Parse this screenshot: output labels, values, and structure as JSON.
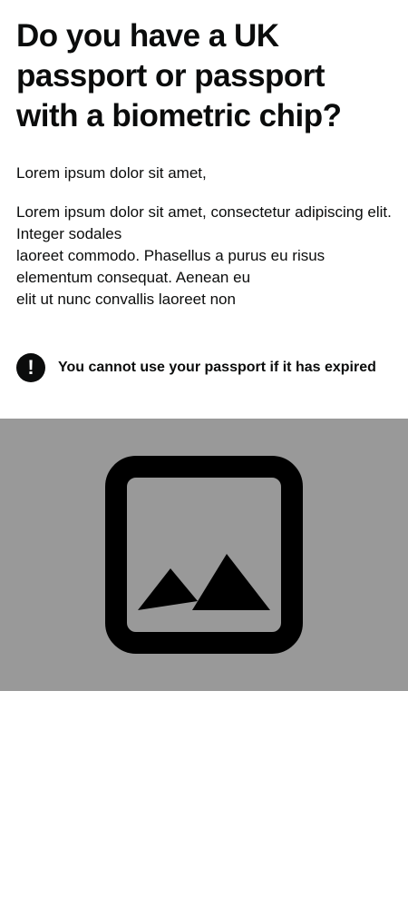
{
  "page": {
    "title": "Do you have a UK passport or passport with a biometric chip?",
    "intro": "Lorem ipsum dolor sit amet,",
    "body_lines": [
      "Lorem ipsum dolor sit amet, consectetur adipiscing elit. Integer sodales",
      "laoreet commodo. Phasellus a purus eu risus elementum consequat. Aenean eu",
      "elit ut nunc convallis laoreet non"
    ]
  },
  "warning": {
    "icon": "exclamation-icon",
    "symbol": "!",
    "text": "You cannot use your passport if it has expired"
  },
  "image": {
    "icon": "image-placeholder-icon",
    "background_color": "#999999",
    "icon_color": "#000000"
  }
}
